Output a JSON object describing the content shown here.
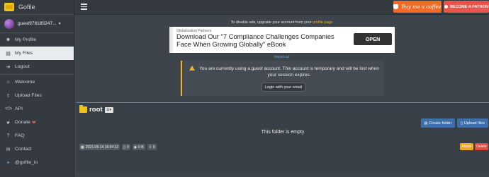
{
  "app": {
    "name": "Gofile"
  },
  "user": {
    "name": "guest978185247..."
  },
  "sidebar": {
    "items": [
      {
        "label": "My Profile",
        "icon": "user-icon"
      },
      {
        "label": "My Files",
        "icon": "folder-icon",
        "active": true
      },
      {
        "label": "Logout",
        "icon": "logout-icon"
      },
      {
        "label": "Welcome",
        "icon": "home-icon"
      },
      {
        "label": "Upload Files",
        "icon": "upload-icon"
      },
      {
        "label": "API",
        "icon": "code-icon"
      },
      {
        "label": "Donate",
        "icon": "donate-icon"
      },
      {
        "label": "FAQ",
        "icon": "question-icon"
      },
      {
        "label": "Contact",
        "icon": "mail-icon"
      },
      {
        "label": "@gofile_io",
        "icon": "twitter-icon"
      }
    ]
  },
  "topbar": {
    "coffee_label": "Buy me a coffee",
    "patron_label": "BECOME A PATRON"
  },
  "ads": {
    "note_prefix": "To disable ads, upgrade your account from your",
    "note_link": "profile page",
    "partner": "Globalization Partners",
    "headline": "Download Our \"7 Compliance Challenges Companies Face When Growing Globally\" eBook",
    "cta": "OPEN",
    "report": "Report Ad"
  },
  "alert": {
    "message": "You are currently using a guest account. This account is temporary and will be lost when your session expires.",
    "button": "Login with your email"
  },
  "folder": {
    "name": "root",
    "empty_text": "This folder is empty",
    "create_label": "Create folder",
    "upload_label": "Upload files",
    "date": "2021-09-14 16:04:12",
    "files_count": "0",
    "size": "0 B",
    "downloads": "0",
    "abuse_label": "Abuse",
    "delete_label": "Delete"
  },
  "colors": {
    "sidebar_bg": "#343a40",
    "content_bg": "#3e444c",
    "accent_yellow": "#f0b429",
    "coffee_orange": "#f26b25",
    "patron_red": "#e8544e",
    "primary_blue": "#3d6fa8",
    "delete_red": "#e04b3f"
  }
}
